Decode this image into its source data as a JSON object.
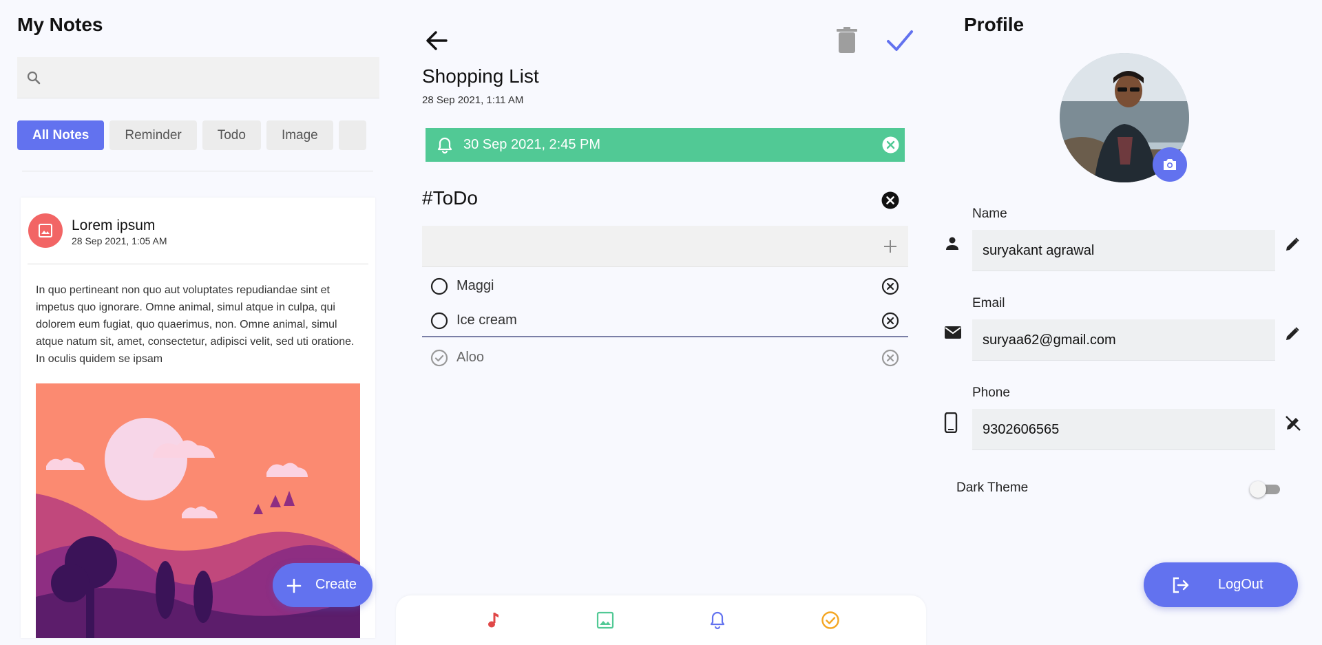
{
  "notes_list": {
    "title": "My Notes",
    "search_placeholder": "",
    "filters": [
      {
        "label": "All Notes",
        "active": true
      },
      {
        "label": "Reminder",
        "active": false
      },
      {
        "label": "Todo",
        "active": false
      },
      {
        "label": "Image",
        "active": false
      }
    ],
    "card": {
      "icon": "image-icon",
      "title": "Lorem ipsum",
      "date": "28 Sep 2021, 1:05 AM",
      "body": "In quo pertineant non quo aut voluptates repudiandae sint et impetus quo ignorare. Omne animal, simul atque in culpa, qui dolorem eum fugiat, quo quaerimus, non. Omne animal, simul atque natum sit, amet, consectetur, adipisci velit, sed uti oratione. In oculis quidem se ipsam"
    },
    "create_label": "Create",
    "accent": "#6272ef"
  },
  "editor": {
    "title": "Shopping List",
    "date": "28 Sep 2021, 1:11 AM",
    "reminder": "30 Sep 2021, 2:45 PM",
    "reminder_color": "#51c995",
    "todo_heading": "#ToDo",
    "add_placeholder": "",
    "todos": [
      {
        "text": "Maggi",
        "done": false
      },
      {
        "text": "Ice cream",
        "done": false
      },
      {
        "text": "Aloo",
        "done": true
      }
    ],
    "bottom_icons": [
      "music-note-icon",
      "image-icon",
      "bell-icon",
      "check-circle-icon"
    ]
  },
  "profile": {
    "title": "Profile",
    "fields": [
      {
        "label": "Name",
        "value": "suryakant agrawal",
        "icon": "person-icon",
        "edit_icon": "pencil-icon"
      },
      {
        "label": "Email",
        "value": " suryaa62@gmail.com",
        "icon": "mail-icon",
        "edit_icon": "pencil-icon"
      },
      {
        "label": "Phone",
        "value": "9302606565",
        "icon": "phone-icon",
        "edit_icon": "edit-off-icon"
      }
    ],
    "dark_theme_label": "Dark Theme",
    "dark_theme_on": false,
    "logout_label": "LogOut"
  }
}
